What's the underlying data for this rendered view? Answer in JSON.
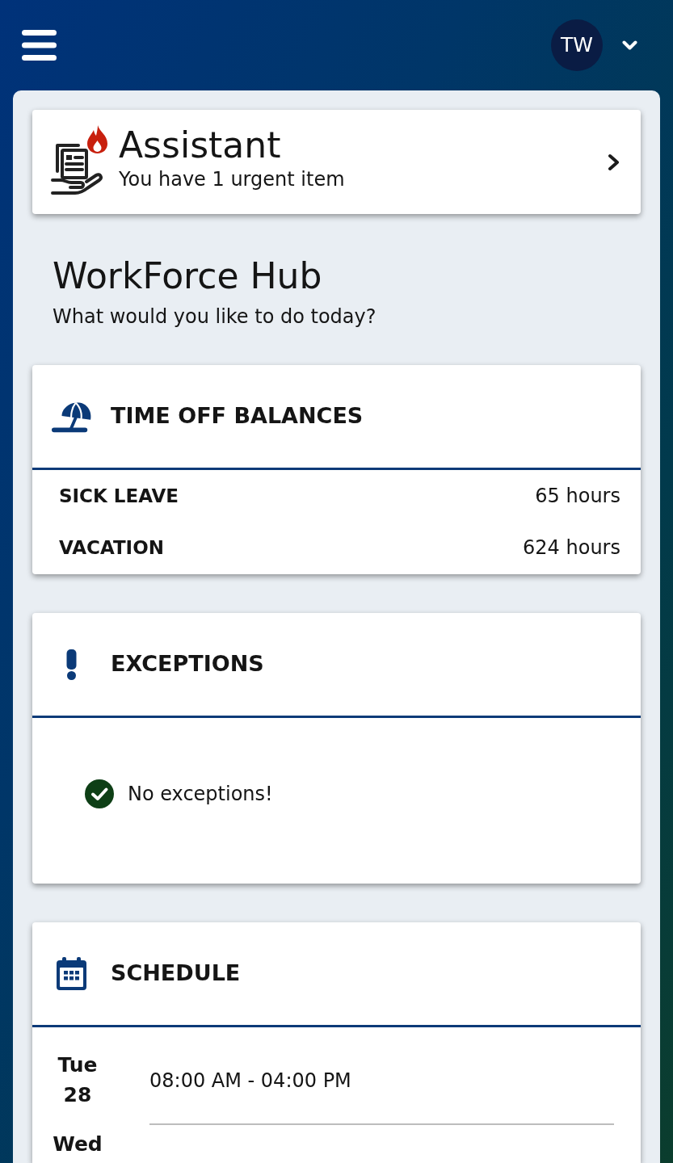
{
  "header": {
    "avatar_initials": "TW"
  },
  "assistant": {
    "title": "Assistant",
    "subtitle": "You have 1 urgent item"
  },
  "hub": {
    "title": "WorkForce Hub",
    "subtitle": "What would you like to do today?"
  },
  "cards": [
    {
      "kind": "balances",
      "title": "TIME OFF BALANCES",
      "rows": [
        {
          "label": "SICK LEAVE",
          "value": "65 hours"
        },
        {
          "label": "VACATION",
          "value": "624 hours"
        }
      ]
    },
    {
      "kind": "exceptions",
      "title": "EXCEPTIONS",
      "message": "No exceptions!"
    },
    {
      "kind": "schedule",
      "title": "SCHEDULE",
      "days": [
        {
          "weekday": "Tue",
          "date": "28",
          "shift": "08:00 AM - 04:00 PM"
        },
        {
          "weekday": "Wed"
        }
      ]
    }
  ]
}
